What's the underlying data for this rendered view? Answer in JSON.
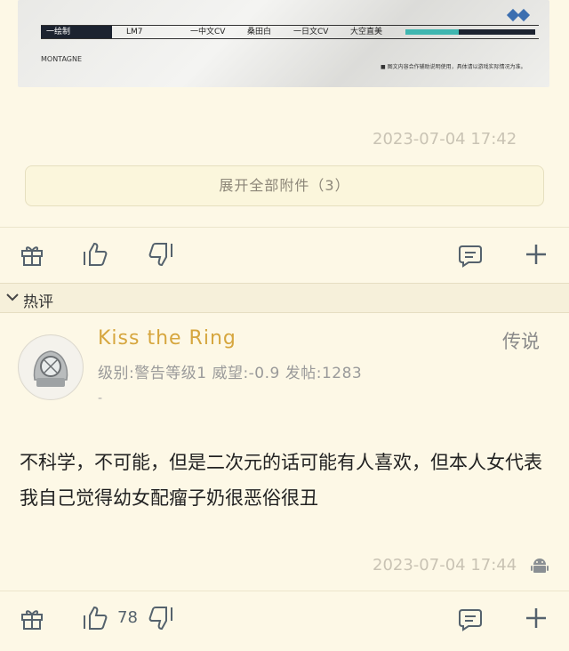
{
  "attachment_image": {
    "bar_items": [
      "一绘制",
      "LM7",
      "一中文CV",
      "桑田白",
      "一日文CV",
      "大空直美"
    ],
    "logo_text": "MONTAGNE",
    "note_text": "■ 图文内容合作辅助说明使用，具体请以游戏实际情况为准。"
  },
  "post": {
    "timestamp": "2023-07-04 17:42",
    "expand_attachments_label": "展开全部附件（3）"
  },
  "hot_section": {
    "title": "热评"
  },
  "comment": {
    "username": "Kiss the Ring",
    "rank_label": "传说",
    "meta": "级别:警告等级1  威望:-0.9  发帖:1283",
    "meta2": "-",
    "text": "不科学，不可能，但是二次元的话可能有人喜欢，但本人女代表我自己觉得幼女配瘤子奶很恶俗很丑",
    "timestamp": "2023-07-04 17:44",
    "like_count": "78"
  },
  "colors": {
    "background": "#fdf8e6",
    "username": "#d6a63e",
    "icon": "#55626d",
    "timestamp": "#c9c3b4"
  },
  "icons": [
    "gift-icon",
    "thumbs-up-icon",
    "thumbs-down-icon",
    "comment-icon",
    "plus-icon",
    "chevron-down-icon",
    "android-icon"
  ]
}
